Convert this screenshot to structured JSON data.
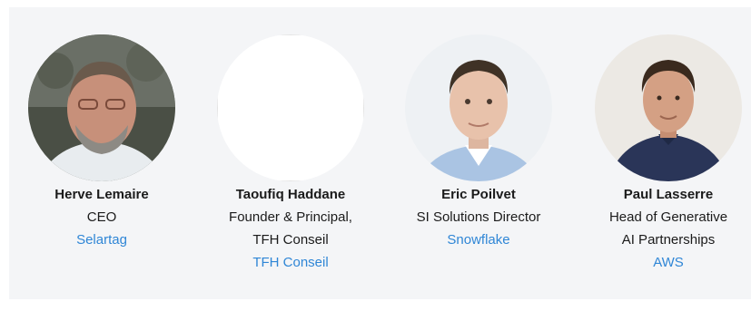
{
  "speakers": [
    {
      "name": "Herve Lemaire",
      "title_lines": [
        "CEO"
      ],
      "company": "Selartag"
    },
    {
      "name": "Taoufiq Haddane",
      "title_lines": [
        "Founder & Principal,",
        "TFH Conseil"
      ],
      "company": "TFH Conseil"
    },
    {
      "name": "Eric Poilvet",
      "title_lines": [
        "SI Solutions Director"
      ],
      "company": "Snowflake"
    },
    {
      "name": "Paul Lasserre",
      "title_lines": [
        "Head of Generative",
        "AI Partnerships"
      ],
      "company": "AWS"
    }
  ],
  "colors": {
    "panel": "#f4f5f7",
    "text": "#1b1b1b",
    "link": "#2f86d6"
  }
}
